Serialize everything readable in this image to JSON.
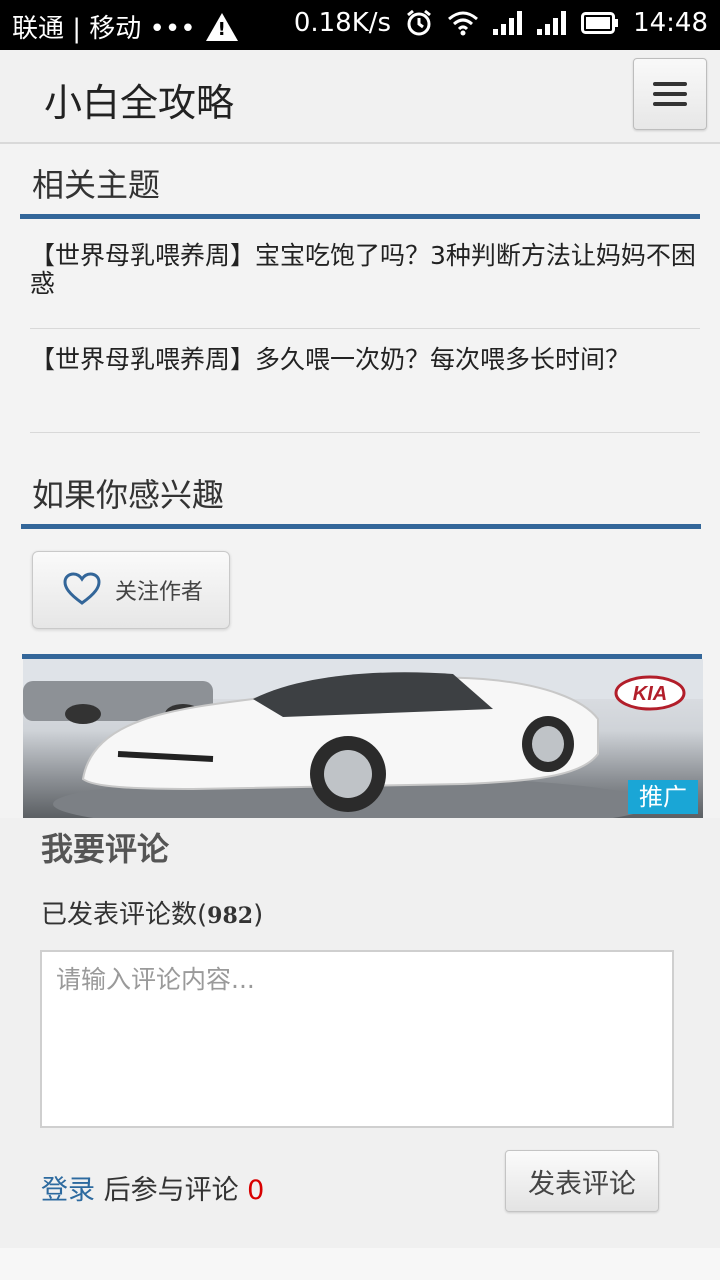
{
  "status_bar": {
    "carriers": "联通 | 移动 •••",
    "warning_icon": "warning-icon",
    "net_speed": "0.18K/s",
    "alarm_icon": "alarm-icon",
    "wifi_icon": "wifi-icon",
    "signal_icon": "signal-icon",
    "battery_icon": "battery-icon",
    "time": "14:48"
  },
  "app_bar": {
    "title": "小白全攻略",
    "menu_icon": "hamburger-menu-icon"
  },
  "related": {
    "heading": "相关主题",
    "items": [
      {
        "title": "【世界母乳喂养周】宝宝吃饱了吗？3种判断方法让妈妈不困惑"
      },
      {
        "title": "【世界母乳喂养周】多久喂一次奶？每次喂多长时间？"
      }
    ]
  },
  "interest": {
    "heading": "如果你感兴趣",
    "follow_label": "关注作者",
    "follow_icon": "heart-icon"
  },
  "ad": {
    "tag": "推广",
    "brand": "KIA"
  },
  "comments": {
    "heading": "我要评论",
    "count_prefix": "已发表评论数(",
    "count": "982",
    "count_suffix": ")",
    "placeholder": "请输入评论内容...",
    "login_link": "登录",
    "login_suffix": " 后参与评论 ",
    "login_count": "0",
    "submit_label": "发表评论"
  },
  "colors": {
    "accent_rule": "#336699",
    "ad_tag": "#1aa6d6",
    "link": "#2d6a9f",
    "count_red": "#d80000"
  }
}
